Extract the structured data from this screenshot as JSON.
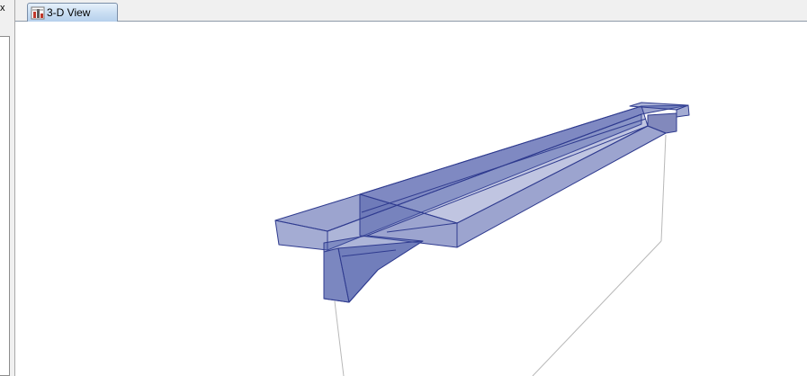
{
  "left_panel": {
    "close_glyph": "x"
  },
  "tabs": [
    {
      "label": "3-D View",
      "icon": "3d-view-icon",
      "active": true
    }
  ],
  "viewport": {
    "model": "transparent-beam-girder",
    "fill_color": "#4a5aa8",
    "edge_color": "#2f3b8f",
    "support_line_color": "#b8b8b8"
  }
}
